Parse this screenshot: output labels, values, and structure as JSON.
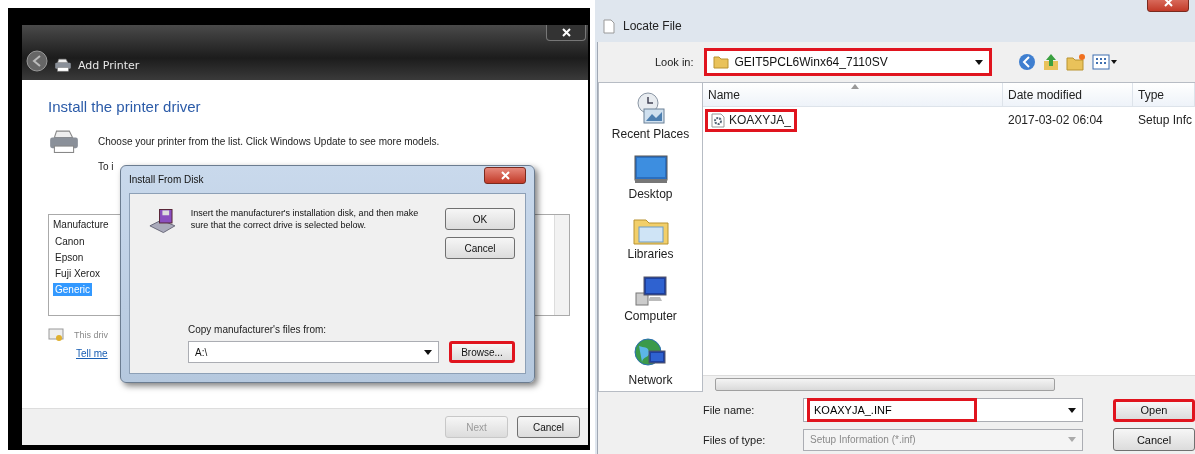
{
  "add_printer": {
    "title": "Add Printer",
    "heading": "Install the printer driver",
    "instruction": "Choose your printer from the list. Click Windows Update to see more models.",
    "instruction_2": "To i",
    "manufacturer_list": {
      "header": "Manufacture",
      "items": [
        {
          "label": "Canon",
          "selected": false
        },
        {
          "label": "Epson",
          "selected": false
        },
        {
          "label": "Fuji Xerox",
          "selected": false
        },
        {
          "label": "Generic",
          "selected": true
        }
      ]
    },
    "driver_note": "This driv",
    "link": "Tell me",
    "buttons": [
      {
        "label": "Next",
        "disabled": true
      },
      {
        "label": "Cancel",
        "disabled": false
      }
    ]
  },
  "install_from_disk": {
    "title": "Install From Disk",
    "message": "Insert the manufacturer's installation disk, and then make sure that the correct drive is selected below.",
    "buttons": [
      {
        "label": "OK",
        "highlighted": false
      },
      {
        "label": "Cancel",
        "highlighted": false
      }
    ],
    "copy_label": "Copy manufacturer's files from:",
    "path": "A:\\",
    "browse": {
      "label": "Browse...",
      "highlighted": true
    }
  },
  "locate_file": {
    "title": "Locate File",
    "look_in_label": "Look in:",
    "look_in": {
      "value": "GEIT5PCL6Winx64_7110SV",
      "highlighted": true
    },
    "places": [
      {
        "kind": "recent",
        "label": "Recent Places"
      },
      {
        "kind": "desktop",
        "label": "Desktop"
      },
      {
        "kind": "libraries",
        "label": "Libraries"
      },
      {
        "kind": "computer",
        "label": "Computer"
      },
      {
        "kind": "network",
        "label": "Network"
      }
    ],
    "columns": [
      "Name",
      "Date modified",
      "Type"
    ],
    "files": [
      {
        "name": "KOAXYJA_",
        "date": "2017-03-02 06:04",
        "type": "Setup Infc",
        "highlighted": true
      }
    ],
    "file_name_label": "File name:",
    "file_name": {
      "value": "KOAXYJA_.INF",
      "highlighted": true
    },
    "file_type_label": "Files of type:",
    "file_type": {
      "value": "Setup Information (*.inf)",
      "disabled": true
    },
    "buttons": [
      {
        "label": "Open",
        "highlighted": true
      },
      {
        "label": "Cancel",
        "highlighted": false
      }
    ]
  }
}
